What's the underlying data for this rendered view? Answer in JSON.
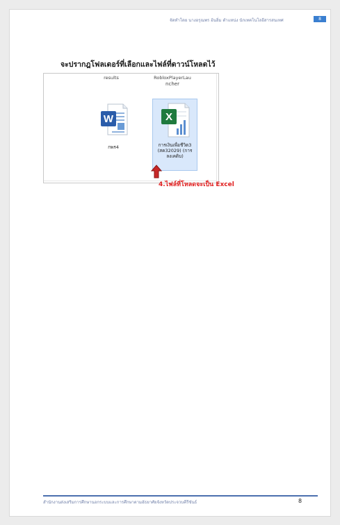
{
  "header": {
    "running_title": "จัดทำโดย นางอรุณพร อ้นอิ่ม ตำแหน่ง นักเทคโนโลยีสารสนเทศ",
    "page_number": "8"
  },
  "heading": "จะปรากฎโฟลเดอร์ที่เลือกและไฟล์ที่ดาวน์โหลดไว้",
  "explorer": {
    "cut_items": [
      "results",
      "RobloxPlayerLaunch\nncher"
    ],
    "cut_labels": [
      "results",
      "RobloxPlayerLau",
      "ncher"
    ],
    "files": [
      {
        "label": "กพร4",
        "icon": "word-file-icon"
      },
      {
        "label": "การเงินเพื่อชีวิต3 (สค32029) (การ ลงเคดิบ)",
        "lines": [
          "การเงินเพื่อชีวิต3",
          "(สค32029) (การ",
          "ลงเคดิบ)"
        ],
        "icon": "excel-file-icon",
        "selected": true
      }
    ]
  },
  "callout": "4.ไฟล์ที่โหลดจะเป็น Excel",
  "colors": {
    "callout": "#e02020",
    "badge": "#3a7fd0",
    "footer_rule": "#4a6fae",
    "selection": "#d9e8fb"
  },
  "footer": {
    "text": "สำนักงานส่งเสริมการศึกษานอกระบบและการศึกษาตามอัธยาศัยจังหวัดประจวบคีรีขันธ์",
    "page_number": "8"
  }
}
